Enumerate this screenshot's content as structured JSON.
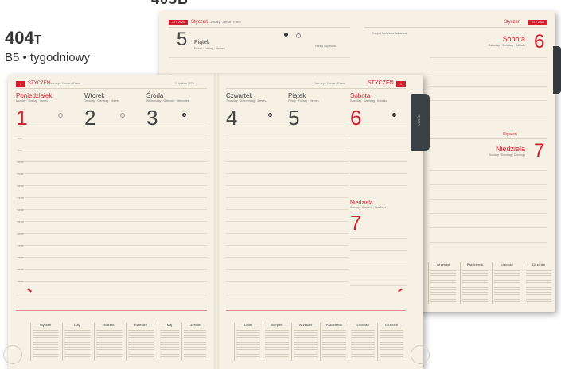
{
  "product": {
    "partial_code": "405B",
    "code": "404",
    "code_suffix": "T",
    "subtitle": "B5 • tygodniowy"
  },
  "back_planner": {
    "tag_left": "STY 2024",
    "tag_right": "STY 2024",
    "month_left": "Styczeń",
    "month_left_sub": "January · Januar · Enero",
    "month_right": "Styczeń",
    "day_left": {
      "num": "5",
      "name": "Piątek",
      "sub": "Friday · Freitag · Viernes"
    },
    "day_right": {
      "num": "6",
      "name": "Sobota",
      "sub": "Saturday · Samstag · Sábado"
    },
    "day_sun": {
      "num": "7",
      "name": "Niedziela",
      "sub": "Sunday · Sonntag · Domingo",
      "month": "Styczeń"
    },
    "name_days_left": "Hanny Szymona",
    "name_days_right": "Kacpra Melchiora Baltazara",
    "bottom_months": [
      "Wrzesień",
      "Październik",
      "Listopad",
      "Grudzień"
    ]
  },
  "front_planner": {
    "week_badge": "1",
    "month": "STYCZEŃ",
    "month_sub": "January · Januar · Enero",
    "week_label": "1. tydzień 2024",
    "month_right": "STYCZEŃ",
    "days": [
      {
        "num": "1",
        "name": "Poniedziałek",
        "sub": "Monday · Montag · Lunes",
        "color": "#d0202e"
      },
      {
        "num": "2",
        "name": "Wtorek",
        "sub": "Tuesday · Dienstag · Martes",
        "color": "#444444"
      },
      {
        "num": "3",
        "name": "Środa",
        "sub": "Wednesday · Mittwoch · Miércoles",
        "color": "#444444"
      },
      {
        "num": "4",
        "name": "Czwartek",
        "sub": "Thursday · Donnerstag · Jueves",
        "color": "#444444"
      },
      {
        "num": "5",
        "name": "Piątek",
        "sub": "Friday · Freitag · Viernes",
        "color": "#444444"
      },
      {
        "num": "6",
        "name": "Sobota",
        "sub": "Saturday · Samstag · Sábado",
        "color": "#d0202e"
      }
    ],
    "sunday": {
      "num": "7",
      "name": "Niedziela",
      "sub": "Sunday · Sonntag · Domingo"
    },
    "hours": [
      "7:00",
      "8:00",
      "9:00",
      "10:00",
      "11:00",
      "12:00",
      "13:00",
      "14:00",
      "15:00",
      "16:00",
      "17:00",
      "18:00",
      "19:00",
      "20:00"
    ],
    "left_months": [
      "Styczeń",
      "Luty",
      "Marzec",
      "Kwiecień",
      "Maj",
      "Czerwiec"
    ],
    "right_months": [
      "Lipiec",
      "Sierpień",
      "Wrzesień",
      "Październik",
      "Listopad",
      "Grudzień"
    ],
    "tab_label": "Styczeń"
  }
}
